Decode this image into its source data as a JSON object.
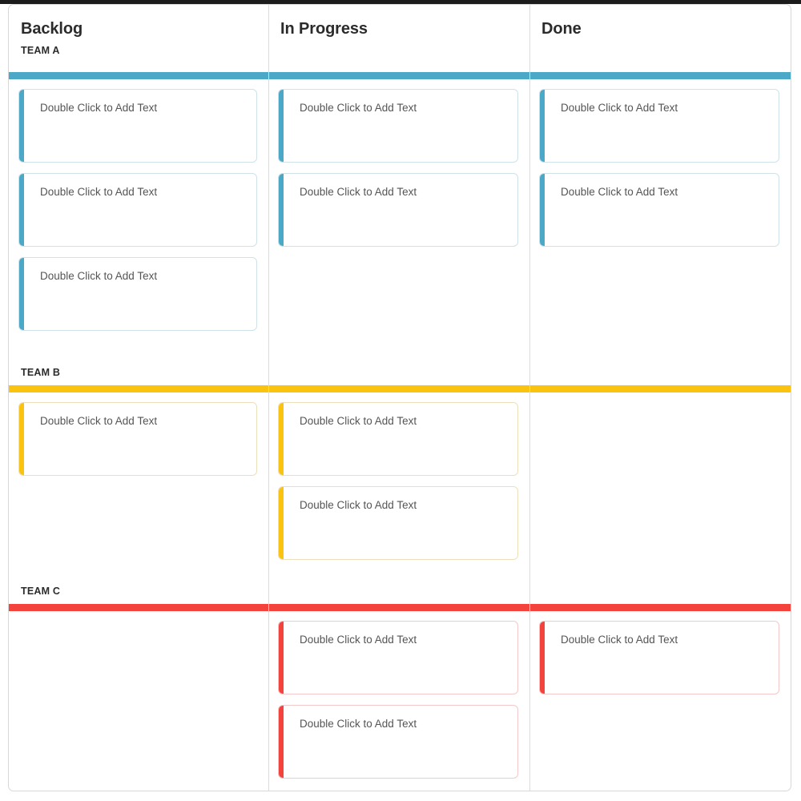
{
  "board": {
    "card_placeholder": "Double Click to Add Text",
    "colors": {
      "team_a": "#4ba8c6",
      "team_b": "#f9c310",
      "team_c": "#f4433c",
      "card_text": "#555555",
      "heading_text": "#2b2b2b",
      "divider": "#dcdcdc"
    },
    "columns": [
      {
        "id": "backlog",
        "title": "Backlog"
      },
      {
        "id": "inprogress",
        "title": "In Progress"
      },
      {
        "id": "done",
        "title": "Done"
      }
    ],
    "lanes": [
      {
        "id": "team-a",
        "label": "TEAM A",
        "color": "#4ba8c6",
        "cards": {
          "backlog": [
            "Double Click to Add Text",
            "Double Click to Add Text",
            "Double Click to Add Text"
          ],
          "inprogress": [
            "Double Click to Add Text",
            "Double Click to Add Text"
          ],
          "done": [
            "Double Click to Add Text",
            "Double Click to Add Text"
          ]
        }
      },
      {
        "id": "team-b",
        "label": "TEAM B",
        "color": "#f9c310",
        "cards": {
          "backlog": [
            "Double Click to Add Text"
          ],
          "inprogress": [
            "Double Click to Add Text",
            "Double Click to Add Text"
          ],
          "done": []
        }
      },
      {
        "id": "team-c",
        "label": "TEAM C",
        "color": "#f4433c",
        "cards": {
          "backlog": [],
          "inprogress": [
            "Double Click to Add Text",
            "Double Click to Add Text"
          ],
          "done": [
            "Double Click to Add Text"
          ]
        }
      }
    ]
  }
}
